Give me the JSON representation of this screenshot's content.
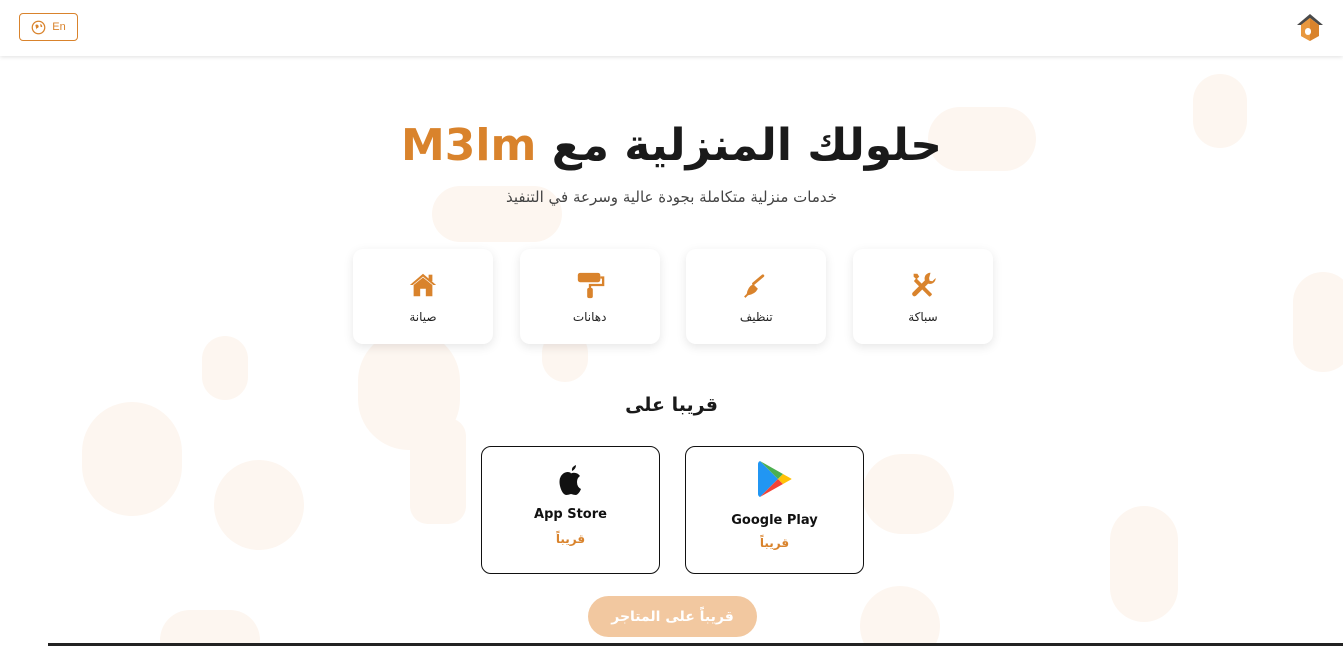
{
  "header": {
    "lang_label": "En",
    "icons": {
      "lang": "globe-icon",
      "logo": "house-logo-icon"
    }
  },
  "hero": {
    "title_main": "حلولك المنزلية مع",
    "title_brand": "M3lm",
    "subtitle": "خدمات منزلية متكاملة بجودة عالية وسرعة في التنفيذ"
  },
  "services": [
    {
      "label": "سباكة",
      "icon": "wrench-screwdriver-icon"
    },
    {
      "label": "تنظيف",
      "icon": "broom-icon"
    },
    {
      "label": "دهانات",
      "icon": "paint-roller-icon"
    },
    {
      "label": "صيانة",
      "icon": "home-icon"
    }
  ],
  "soon": {
    "title": "قريبا على",
    "stores": [
      {
        "name": "App Store",
        "status": "قريباً",
        "icon": "apple-icon"
      },
      {
        "name": "Google Play",
        "status": "قريباً",
        "icon": "google-play-icon"
      }
    ],
    "cta_label": "قريباً على المتاجر"
  },
  "colors": {
    "accent": "#d9832c",
    "cta_bg": "#f2c8a0",
    "blob": "#fdf6f0"
  }
}
